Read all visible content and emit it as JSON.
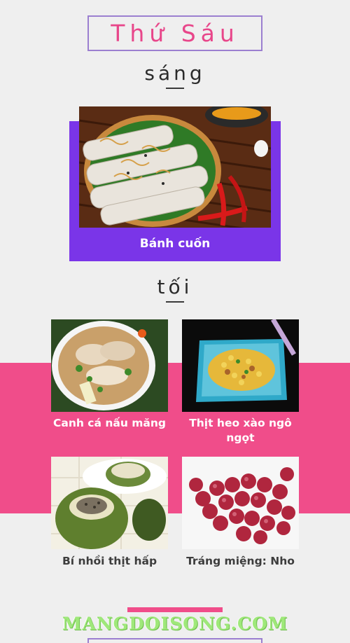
{
  "day_title": "Thứ Sáu",
  "morning": {
    "label": "sáng",
    "dish": {
      "name": "Bánh cuốn",
      "image": "banh-cuon-photo"
    }
  },
  "evening": {
    "label": "tối",
    "dishes": [
      {
        "name": "Canh cá nấu măng",
        "image": "fish-soup-photo"
      },
      {
        "name": "Thịt heo xào ngô ngọt",
        "image": "pork-corn-photo"
      },
      {
        "name": "Bí nhồi thịt hấp",
        "image": "stuffed-squash-photo"
      },
      {
        "name": "Tráng miệng: Nho",
        "image": "grapes-photo"
      }
    ]
  },
  "watermark": "MANGDOISONG.COM",
  "colors": {
    "accent_pink": "#f04d8a",
    "accent_purple": "#7a35e8",
    "frame": "#9b7fd0"
  }
}
